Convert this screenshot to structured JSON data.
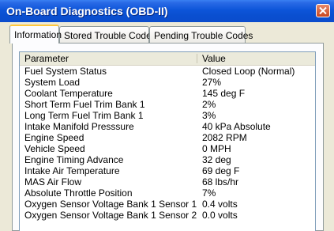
{
  "window": {
    "title": "On-Board Diagnostics (OBD-II)"
  },
  "tabs": [
    {
      "label": "Information",
      "active": true
    },
    {
      "label": "Stored Trouble Codes",
      "active": false
    },
    {
      "label": "Pending Trouble Codes",
      "active": false
    }
  ],
  "table": {
    "headers": {
      "parameter": "Parameter",
      "value": "Value"
    },
    "rows": [
      {
        "parameter": "Fuel System Status",
        "value": "Closed Loop (Normal)"
      },
      {
        "parameter": "System Load",
        "value": "27%"
      },
      {
        "parameter": "Coolant Temperature",
        "value": "145 deg F"
      },
      {
        "parameter": "Short Term Fuel Trim Bank 1",
        "value": "2%"
      },
      {
        "parameter": "Long Term Fuel Trim Bank 1",
        "value": "3%"
      },
      {
        "parameter": "Intake Manifold Presssure",
        "value": "40 kPa Absolute"
      },
      {
        "parameter": "Engine Speed",
        "value": "2082 RPM"
      },
      {
        "parameter": "Vehicle Speed",
        "value": "0 MPH"
      },
      {
        "parameter": "Engine Timing Advance",
        "value": "32 deg"
      },
      {
        "parameter": "Intake Air Temperature",
        "value": "69 deg F"
      },
      {
        "parameter": "MAS Air Flow",
        "value": "68 lbs/hr"
      },
      {
        "parameter": "Absolute Throttle Position",
        "value": "7%"
      },
      {
        "parameter": "Oxygen Sensor Voltage Bank 1 Sensor 1",
        "value": "0.4 volts"
      },
      {
        "parameter": "Oxygen Sensor Voltage Bank 1 Sensor 2",
        "value": "0.0 volts"
      }
    ]
  }
}
